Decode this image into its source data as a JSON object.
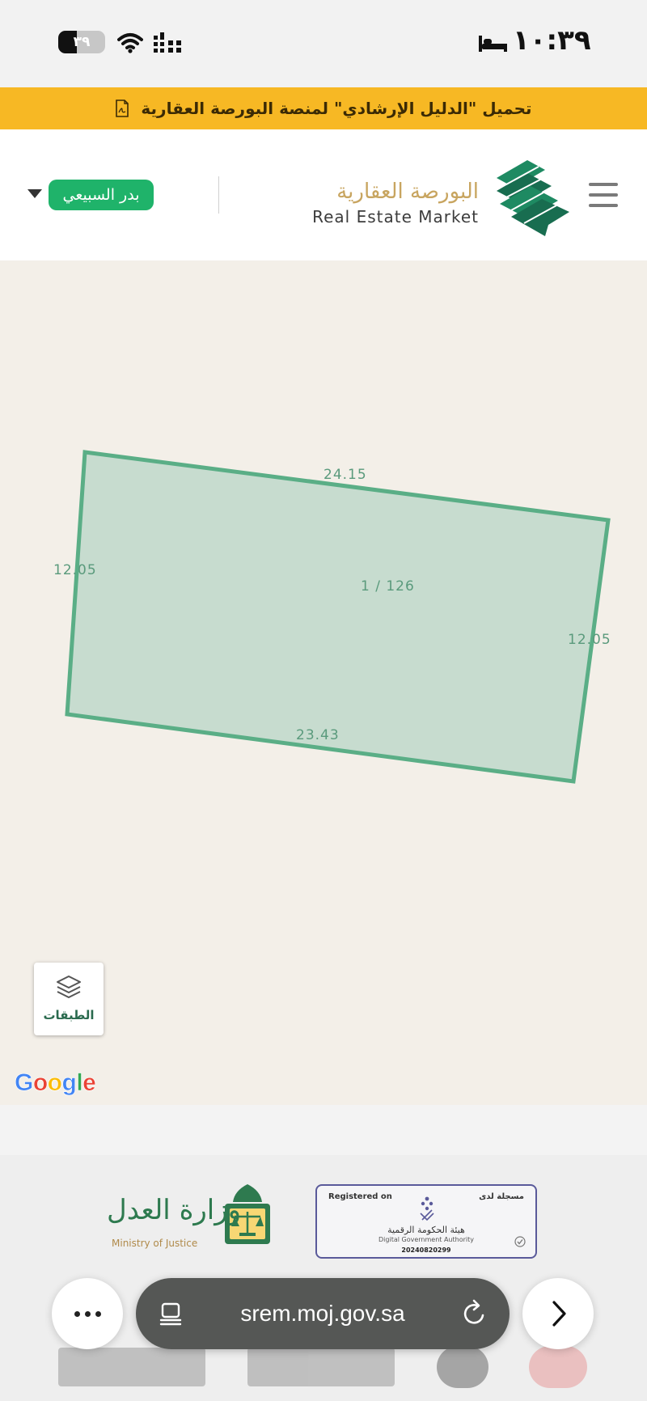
{
  "status_bar": {
    "time": "١٠:٣٩",
    "battery_level": "٣٩",
    "battery_fraction": 0.39,
    "icons": [
      "sleep-focus-icon",
      "wifi-icon",
      "cellular-signal-icon",
      "battery-icon"
    ]
  },
  "banner": {
    "text": "تحميل \"الدليل الإرشادي\" لمنصة البورصة العقارية",
    "icon": "pdf-file-icon",
    "background": "#f7b824"
  },
  "header": {
    "menu_icon": "hamburger-menu-icon",
    "logo_ar": "البورصة العقارية",
    "logo_en": "Real Estate Market",
    "user_name": "بدر السبيعي",
    "user_badge_color": "#1fb36a"
  },
  "map": {
    "parcel_label": "1 / 126",
    "dimensions": {
      "top": "24.15",
      "bottom": "23.43",
      "left": "12.05",
      "right": "12.05"
    },
    "parcel_stroke": "#5aae86",
    "parcel_fill": "#c7dccf",
    "layers_label": "الطبقات",
    "provider_logo": "Google"
  },
  "footer": {
    "registered_en": "Registered on",
    "registered_ar": "مسجلة لدى",
    "authority_ar": "هيئة الحكومة الرقمية",
    "authority_en": "Digital Government Authority",
    "registration_number": "20240820299",
    "ministry_ar": "وزارة العدل",
    "ministry_en": "Ministry of Justice"
  },
  "browser": {
    "url": "srem.moj.gov.sa",
    "more_icon": "more-dots-icon",
    "reader_icon": "reader-mode-icon",
    "reload_icon": "reload-icon",
    "forward_icon": "chevron-right-icon"
  }
}
